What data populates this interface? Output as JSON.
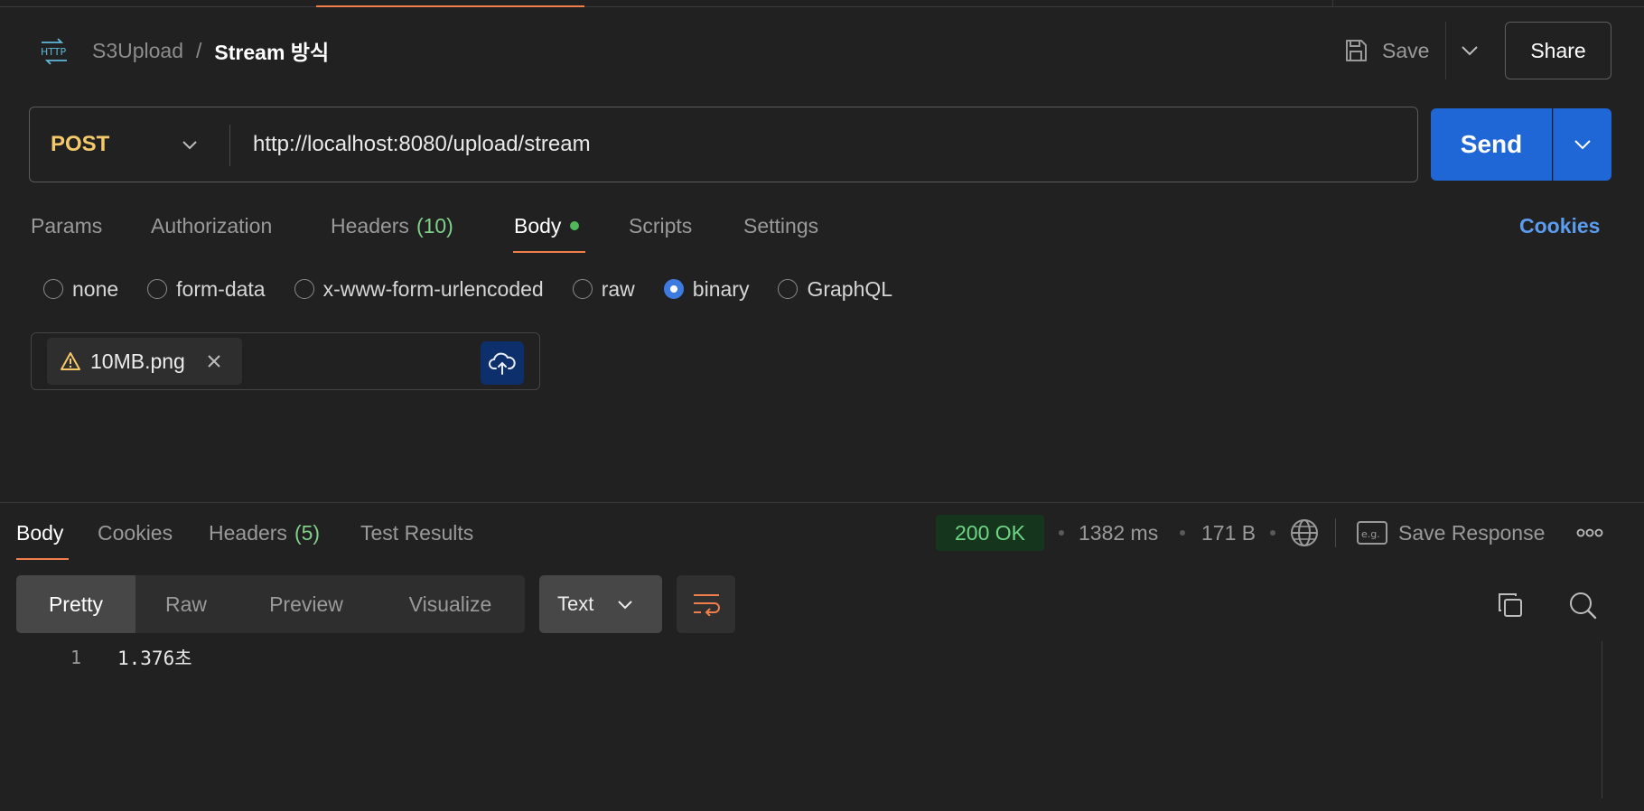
{
  "header": {
    "http_badge": "HTTP",
    "collection": "S3Upload",
    "separator": "/",
    "request_name": "Stream 방식",
    "save_label": "Save",
    "share_label": "Share"
  },
  "request": {
    "method": "POST",
    "url": "http://localhost:8080/upload/stream",
    "send_label": "Send"
  },
  "request_tabs": {
    "params": "Params",
    "authorization": "Authorization",
    "headers": "Headers",
    "headers_count": "(10)",
    "body": "Body",
    "scripts": "Scripts",
    "settings": "Settings",
    "cookies": "Cookies",
    "active": "Body"
  },
  "body_types": {
    "none": "none",
    "form_data": "form-data",
    "urlencoded": "x-www-form-urlencoded",
    "raw": "raw",
    "binary": "binary",
    "graphql": "GraphQL",
    "selected": "binary"
  },
  "file": {
    "name": "10MB.png"
  },
  "response_tabs": {
    "body": "Body",
    "cookies": "Cookies",
    "headers": "Headers",
    "headers_count": "(5)",
    "test_results": "Test Results",
    "active": "Body"
  },
  "response_meta": {
    "status": "200 OK",
    "time": "1382 ms",
    "size": "171 B",
    "save_response": "Save Response",
    "eg_label": "e.g."
  },
  "view": {
    "pretty": "Pretty",
    "raw": "Raw",
    "preview": "Preview",
    "visualize": "Visualize",
    "format": "Text",
    "active": "Pretty"
  },
  "editor": {
    "line_number": "1",
    "line_text": "1.376초"
  },
  "colors": {
    "accent_orange": "#ef7e4a",
    "send_blue": "#1f66d6",
    "method_yellow": "#f4c969",
    "status_green": "#6fd486",
    "link_blue": "#5b9cef"
  }
}
